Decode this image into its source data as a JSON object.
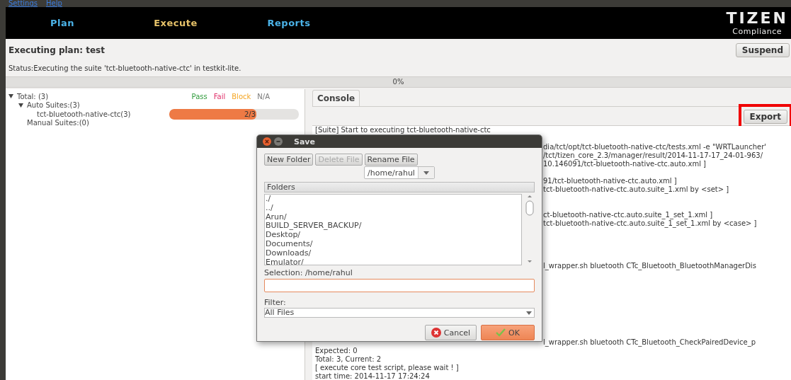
{
  "menu": [
    "Settings",
    "Help"
  ],
  "nav": [
    {
      "label": "Plan",
      "selected": false
    },
    {
      "label": "Execute",
      "selected": true
    },
    {
      "label": "Reports",
      "selected": false
    }
  ],
  "logo": {
    "title": "TIZEN",
    "subtitle": "Compliance"
  },
  "plan_title": "Executing plan: test",
  "suspend_button": "Suspend",
  "status": "Status:Executing the suite 'tct-bluetooth-native-ctc' in testkit-lite.",
  "overall_progress": {
    "level": 0,
    "reading": "0%"
  },
  "legend": [
    {
      "label": "Pass",
      "color": "#2e9a3a"
    },
    {
      "label": "Fail",
      "color": "#e0306a"
    },
    {
      "label": "Block",
      "color": "#f5a623"
    },
    {
      "label": "N/A",
      "color": "#777777"
    }
  ],
  "tree": [
    {
      "label": "Total: (3)",
      "expanded": true,
      "children": [
        {
          "label": "Auto Suites:(3)",
          "expanded": true,
          "children": [
            {
              "label": "tct-bluetooth-native-ctc(3)",
              "progress": {
                "level": 0.67,
                "reading": "2/3"
              }
            }
          ]
        },
        {
          "label": "Manual Suites:(0)"
        }
      ]
    }
  ],
  "console_tab": {
    "label": "Console",
    "selected": true
  },
  "export_button": {
    "label": "Export",
    "highlighted": true
  },
  "console_lines": [
    {
      "kind": "full",
      "text": "[Suite] Start to executing tct-bluetooth-native-ctc"
    },
    {
      "kind": "blank"
    },
    {
      "kind": "tail",
      "text": "dia/tct/opt/tct-bluetooth-native-ctc/tests.xml -e \"WRTLauncher'"
    },
    {
      "kind": "tail",
      "text": "/tct/tizen_core_2.3/manager/result/2014-11-17-17_24-01-963/"
    },
    {
      "kind": "tail",
      "text": "10.146091/tct-bluetooth-native-ctc.auto.xml ]"
    },
    {
      "kind": "blank"
    },
    {
      "kind": "tail",
      "text": "91/tct-bluetooth-native-ctc.auto.xml ]"
    },
    {
      "kind": "tail",
      "text": "tct-bluetooth-native-ctc.auto.suite_1.xml by <set> ]"
    },
    {
      "kind": "blank"
    },
    {
      "kind": "blank"
    },
    {
      "kind": "tail",
      "text": "ct-bluetooth-native-ctc.auto.suite_1_set_1.xml ]"
    },
    {
      "kind": "tail",
      "text": "tct-bluetooth-native-ctc.auto.suite_1_set_1.xml by <case> ]"
    },
    {
      "kind": "blank"
    },
    {
      "kind": "blank"
    },
    {
      "kind": "blank"
    },
    {
      "kind": "blank"
    },
    {
      "kind": "tail",
      "text": "l_wrapper.sh bluetooth CTc_Bluetooth_BluetoothManagerDis"
    },
    {
      "kind": "blank"
    },
    {
      "kind": "blank"
    },
    {
      "kind": "blank"
    },
    {
      "kind": "blank"
    },
    {
      "kind": "blank"
    },
    {
      "kind": "blank"
    },
    {
      "kind": "blank"
    },
    {
      "kind": "blank"
    },
    {
      "kind": "tail",
      "text": "l_wrapper.sh bluetooth CTc_Bluetooth_CheckPairedDevice_p"
    },
    {
      "kind": "full",
      "text": "Expected: 0"
    },
    {
      "kind": "full",
      "text": "Total: 3, Current: 2"
    },
    {
      "kind": "full",
      "text": "[ execute core test script, please wait ! ]"
    },
    {
      "kind": "full",
      "text": "start time: 2014-11-17 17:24:24"
    }
  ],
  "dialog": {
    "title": "Save",
    "buttons": [
      {
        "label": "New Folder",
        "disabled": false
      },
      {
        "label": "Delete File",
        "disabled": true
      },
      {
        "label": "Rename File",
        "disabled": false
      }
    ],
    "path": "/home/rahul",
    "folders_header": "Folders",
    "folders": [
      "./",
      "../",
      "Arun/",
      "BUILD_SERVER_BACKUP/",
      "Desktop/",
      "Documents/",
      "Downloads/",
      "Emulator/"
    ],
    "selection_label": "Selection: /home/rahul",
    "filter_label": "Filter:",
    "filter": "All Files",
    "cancel": "Cancel",
    "ok": "OK"
  }
}
